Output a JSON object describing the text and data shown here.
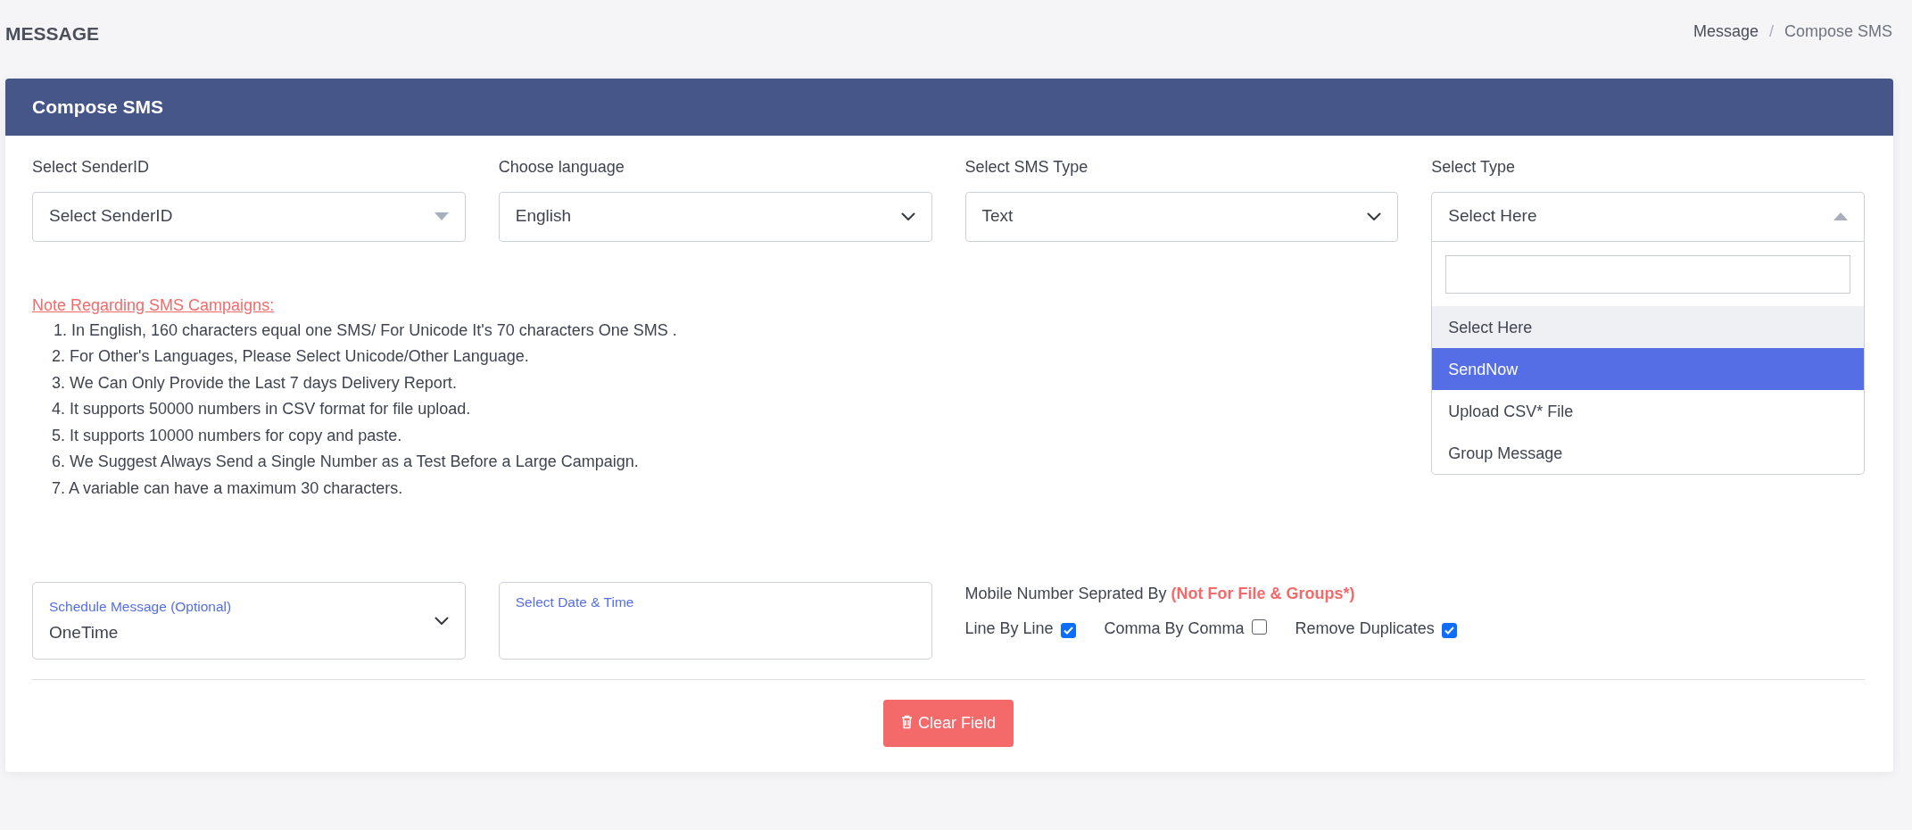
{
  "page": {
    "title": "MESSAGE",
    "breadcrumb_divider": "/",
    "breadcrumb": [
      {
        "label": "Message",
        "active": false
      },
      {
        "label": "Compose SMS",
        "active": true
      }
    ]
  },
  "card": {
    "title": "Compose SMS"
  },
  "fields": [
    {
      "kind": "select2",
      "label": "Select SenderID",
      "value": "Select SenderID",
      "expanded": false
    },
    {
      "kind": "select",
      "label": "Choose language",
      "value": "English"
    },
    {
      "kind": "select",
      "label": "Select SMS Type",
      "value": "Text"
    },
    {
      "kind": "select2",
      "label": "Select Type",
      "value": "Select Here",
      "expanded": true,
      "options": [
        {
          "label": "Select Here",
          "selected": true,
          "highlighted": false
        },
        {
          "label": "SendNow",
          "selected": false,
          "highlighted": true
        },
        {
          "label": "Upload CSV* File",
          "selected": false,
          "highlighted": false
        },
        {
          "label": "Group Message",
          "selected": false,
          "highlighted": false
        }
      ]
    }
  ],
  "notes": {
    "heading": "Note Regarding SMS Campaigns:",
    "items": [
      "1. In English, 160 characters equal one SMS/ For Unicode It's 70 characters One SMS .",
      "2. For Other's Languages, Please Select Unicode/Other Language.",
      "3. We Can Only Provide the Last 7 days Delivery Report.",
      "4. It supports 50000 numbers in CSV format for file upload.",
      "5. It supports 10000 numbers for copy and paste.",
      "6. We Suggest Always Send a Single Number as a Test Before a Large Campaign.",
      "7. A variable can have a maximum 30 characters."
    ]
  },
  "schedule": {
    "label": "Schedule Message (Optional)",
    "value": "OneTime"
  },
  "date_time": {
    "label": "Select Date & Time"
  },
  "separator": {
    "label": "Mobile Number Seprated By",
    "note": "(Not For File & Groups*)",
    "options": [
      {
        "label": "Line By Line",
        "checked": true
      },
      {
        "label": "Comma By Comma",
        "checked": false
      },
      {
        "label": "Remove Duplicates",
        "checked": true
      }
    ]
  },
  "clear_button": {
    "label": "Clear Field"
  }
}
